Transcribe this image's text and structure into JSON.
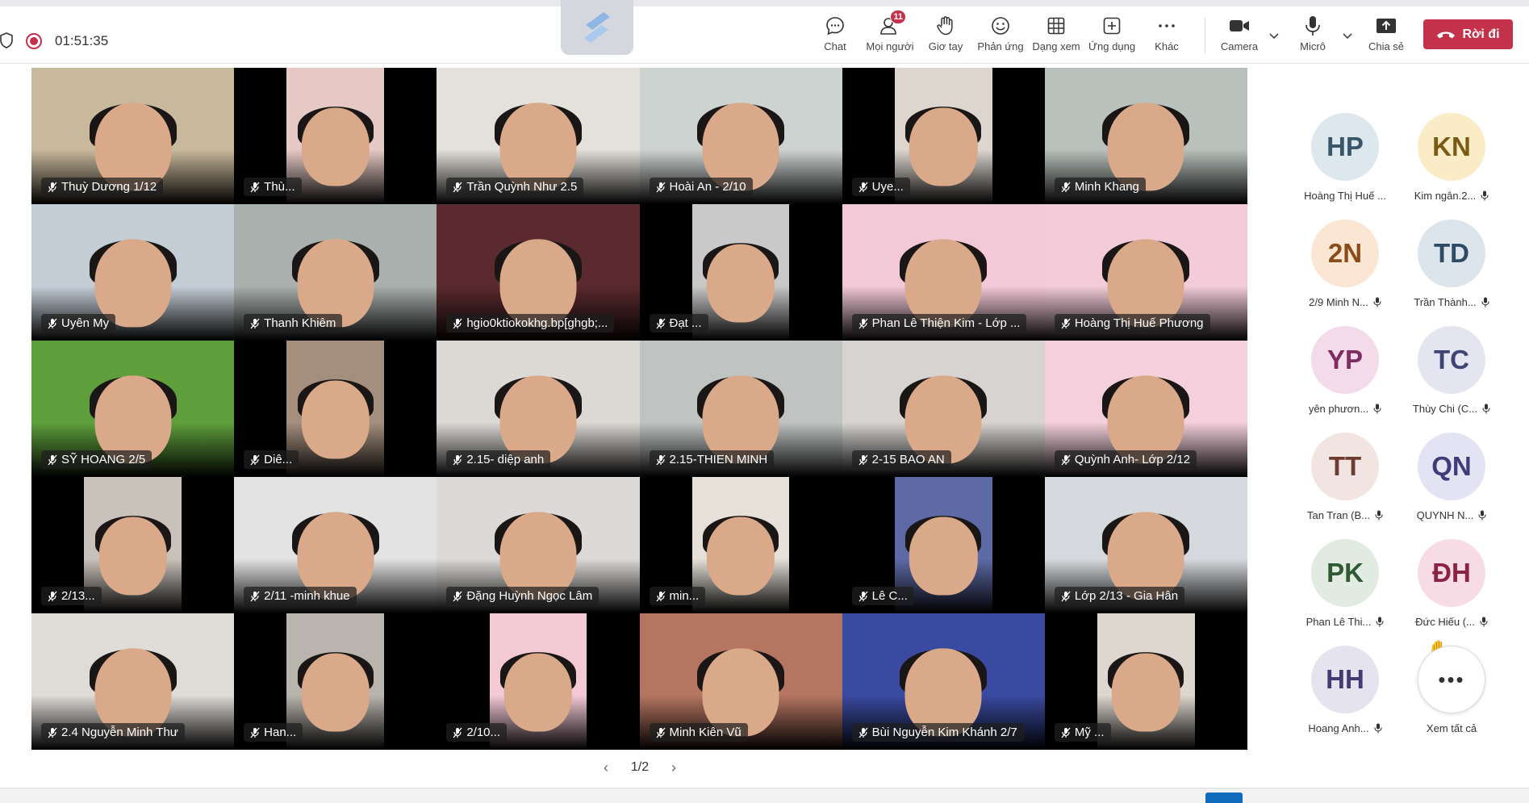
{
  "meeting": {
    "timer": "01:51:35"
  },
  "toolbar": {
    "chat": {
      "label": "Chat",
      "icon": "chat-icon"
    },
    "people": {
      "label": "Mọi người",
      "icon": "people-icon",
      "badge": "11"
    },
    "raise_hand": {
      "label": "Giơ tay",
      "icon": "raise-hand-icon"
    },
    "react": {
      "label": "Phản ứng",
      "icon": "smiley-icon"
    },
    "view": {
      "label": "Dạng xem",
      "icon": "grid-view-icon"
    },
    "apps": {
      "label": "Ứng dụng",
      "icon": "add-apps-icon"
    },
    "more": {
      "label": "Khác",
      "icon": "more-icon"
    },
    "camera": {
      "label": "Camera",
      "icon": "camera-icon"
    },
    "mic": {
      "label": "Micrô",
      "icon": "microphone-icon"
    },
    "share": {
      "label": "Chia sẻ",
      "icon": "share-icon"
    },
    "leave": {
      "label": "Rời đi",
      "icon": "hang-up-icon",
      "color": "#c4314b"
    }
  },
  "grid": {
    "tiles": [
      {
        "name": "Thuỳ Dương 1/12",
        "bg": "#c9b99c",
        "narrow": false
      },
      {
        "name": "Thù...",
        "bg": "#e6c9c4",
        "narrow": true
      },
      {
        "name": "Trần Quỳnh Như 2.5",
        "bg": "#e4e1da",
        "narrow": false
      },
      {
        "name": "Hoài An - 2/10",
        "bg": "#cdd3d0",
        "narrow": false
      },
      {
        "name": "Uye...",
        "bg": "#dcd6cf",
        "narrow": true
      },
      {
        "name": "Minh Khang",
        "bg": "#b9c1bc",
        "narrow": false
      },
      {
        "name": "Uyên My",
        "bg": "#c3cdd6",
        "narrow": false
      },
      {
        "name": "Thanh Khiêm",
        "bg": "#a9b0ad",
        "narrow": false
      },
      {
        "name": "hgio0ktiokokhg.bp[ghgb;...",
        "bg": "#5a2a2e",
        "narrow": false
      },
      {
        "name": "Đạt ...",
        "bg": "#c9c9c9",
        "narrow": true
      },
      {
        "name": "Phan Lê Thiện Kim - Lớp ...",
        "bg": "#f3c9d7",
        "narrow": false
      },
      {
        "name": "Hoàng Thị Huế Phương",
        "bg": "#f3cbd9",
        "narrow": false
      },
      {
        "name": "SỸ HOANG 2/5",
        "bg": "#5e9f3c",
        "narrow": false
      },
      {
        "name": "Diê...",
        "bg": "#a48f7e",
        "narrow": true
      },
      {
        "name": "2.15- diệp anh",
        "bg": "#dcd9d5",
        "narrow": false
      },
      {
        "name": "2.15-THIEN MINH",
        "bg": "#bfc3c2",
        "narrow": false
      },
      {
        "name": "2-15 BAO AN",
        "bg": "#d6d3d0",
        "narrow": false
      },
      {
        "name": "Quỳnh Anh- Lớp 2/12",
        "bg": "#f4d0dc",
        "narrow": false
      },
      {
        "name": "2/13...",
        "bg": "#c9c2ba",
        "narrow": true
      },
      {
        "name": "2/11 -minh khue",
        "bg": "#e3e3e3",
        "narrow": false
      },
      {
        "name": "Đặng Huỳnh Ngọc Lâm",
        "bg": "#dcdad8",
        "narrow": false
      },
      {
        "name": "min...",
        "bg": "#e5e1d8",
        "narrow": true
      },
      {
        "name": "Lê C...",
        "bg": "#5d6aa6",
        "narrow": true
      },
      {
        "name": "Lớp 2/13 - Gia Hân",
        "bg": "#d6d9dd",
        "narrow": false
      },
      {
        "name": "2.4 Nguyễn Minh Thư",
        "bg": "#dfdbd7",
        "narrow": false
      },
      {
        "name": "Han...",
        "bg": "#b9b5ae",
        "narrow": true
      },
      {
        "name": "2/10...",
        "bg": "#f3c9d6",
        "narrow": true
      },
      {
        "name": "Minh Kiên Vũ",
        "bg": "#b57561",
        "narrow": false
      },
      {
        "name": "Bùi Nguyễn Kim Khánh 2/7",
        "bg": "#3a4aa0",
        "narrow": false
      },
      {
        "name": "Mỹ ...",
        "bg": "#ddd7cf",
        "narrow": true
      }
    ]
  },
  "pager": {
    "label": "1/2"
  },
  "roster": {
    "people": [
      {
        "initials": "HP",
        "name": "Hoàng Thị Huế ...",
        "bg": "#dce8ee",
        "fg": "#3a5669",
        "muted": false
      },
      {
        "initials": "KN",
        "name": "Kim ngân.2...",
        "bg": "#fbecc8",
        "fg": "#7a5b14",
        "muted": true
      },
      {
        "initials": "2N",
        "name": "2/9 Minh N...",
        "bg": "#fbe6d4",
        "fg": "#8a4b1a",
        "muted": true
      },
      {
        "initials": "TD",
        "name": "Trần Thành...",
        "bg": "#dce4ec",
        "fg": "#2f4b63",
        "muted": true
      },
      {
        "initials": "YP",
        "name": "yên phươn...",
        "bg": "#f3dbea",
        "fg": "#7e2c62",
        "muted": true
      },
      {
        "initials": "TC",
        "name": "Thùy Chi (C...",
        "bg": "#e4e5f1",
        "fg": "#3f4473",
        "muted": true
      },
      {
        "initials": "TT",
        "name": "Tan Tran (B...",
        "bg": "#f1e4e1",
        "fg": "#6d3c33",
        "muted": true
      },
      {
        "initials": "QN",
        "name": "QUYNH N...",
        "bg": "#e3e3f3",
        "fg": "#3d3d7a",
        "muted": true
      },
      {
        "initials": "PK",
        "name": "Phan Lê Thi...",
        "bg": "#e2ebe1",
        "fg": "#2f5a33",
        "muted": true
      },
      {
        "initials": "ĐH",
        "name": "Đức Hiếu (...",
        "bg": "#f8dce5",
        "fg": "#8a2346",
        "muted": true
      },
      {
        "initials": "HH",
        "name": "Hoang Anh...",
        "bg": "#e6e3f1",
        "fg": "#433b73",
        "muted": true
      }
    ],
    "see_all": "Xem tất cả"
  }
}
